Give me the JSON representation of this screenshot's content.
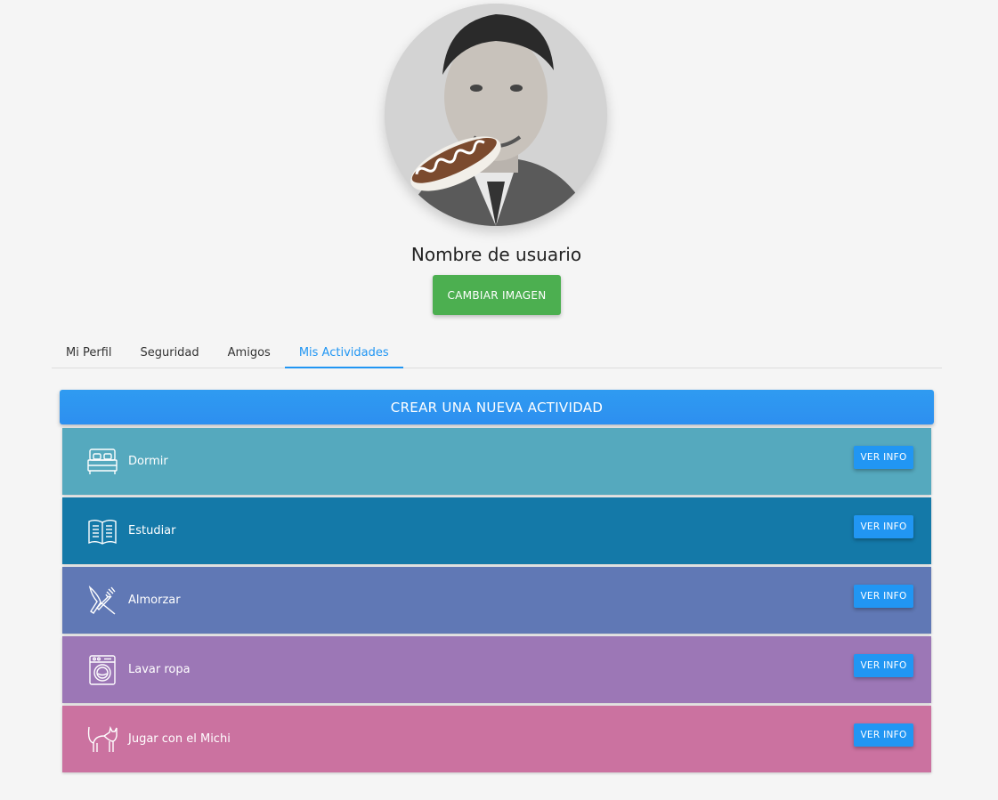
{
  "profile": {
    "username": "Nombre de usuario",
    "change_image_label": "CAMBIAR IMAGEN"
  },
  "tabs": [
    {
      "label": "Mi Perfil",
      "active": false
    },
    {
      "label": "Seguridad",
      "active": false
    },
    {
      "label": "Amigos",
      "active": false
    },
    {
      "label": "Mis Actividades",
      "active": true
    }
  ],
  "actions": {
    "create_label": "CREAR UNA NUEVA ACTIVIDAD"
  },
  "activities": [
    {
      "label": "Dormir",
      "icon": "bed-icon",
      "color": "#55a9be",
      "button": "VER INFO"
    },
    {
      "label": "Estudiar",
      "icon": "book-icon",
      "color": "#1479a8",
      "button": "VER INFO"
    },
    {
      "label": "Almorzar",
      "icon": "cutlery-icon",
      "color": "#6078b5",
      "button": "VER INFO"
    },
    {
      "label": "Lavar ropa",
      "icon": "washing-machine-icon",
      "color": "#9c77b6",
      "button": "VER INFO"
    },
    {
      "label": "Jugar con el Michi",
      "icon": "cat-icon",
      "color": "#cb72a0",
      "button": "VER INFO"
    }
  ],
  "colors": {
    "accent": "#2196f3",
    "change_button": "#4caf50",
    "background": "#f5f5f5"
  }
}
